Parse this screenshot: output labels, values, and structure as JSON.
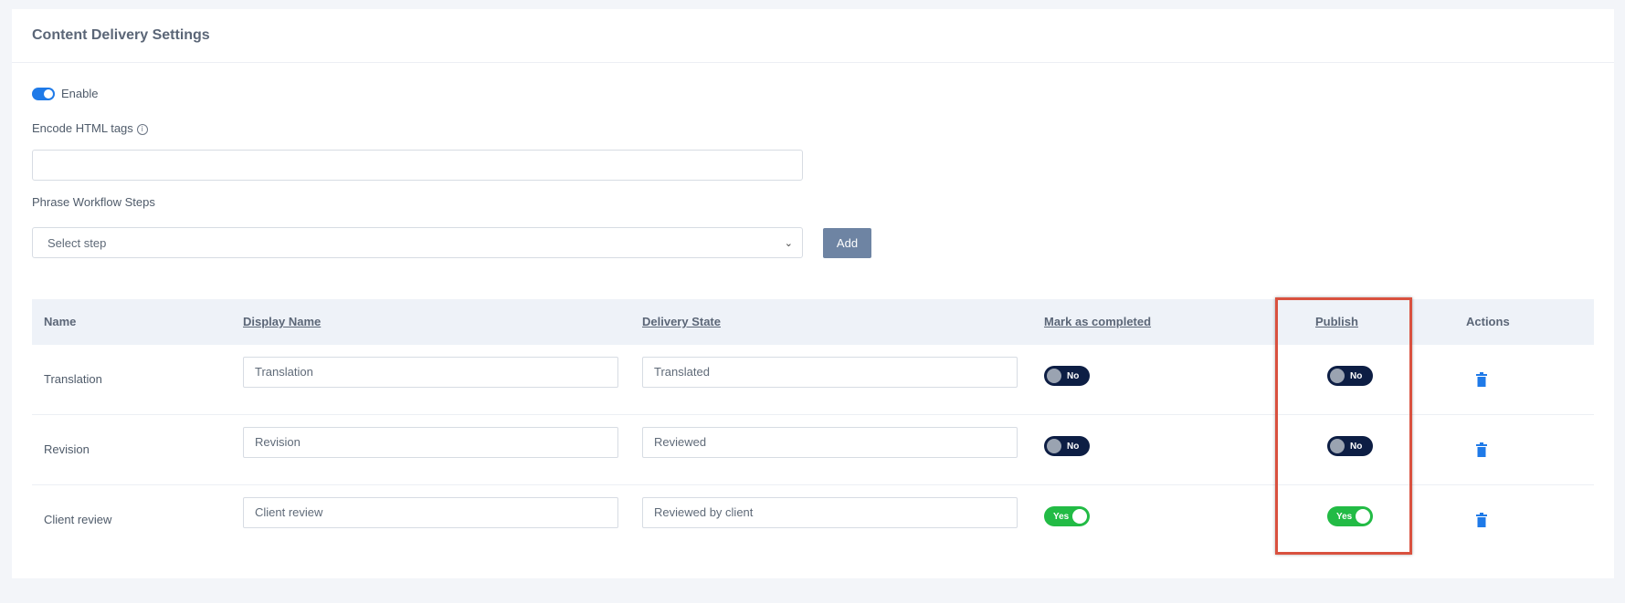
{
  "card": {
    "title": "Content Delivery Settings"
  },
  "enable": {
    "label": "Enable",
    "state": "on"
  },
  "encode": {
    "label": "Encode HTML tags",
    "info_icon": "ⓘ",
    "value": ""
  },
  "workflow": {
    "label": "Phrase Workflow Steps",
    "select_placeholder": "Select step",
    "add_label": "Add"
  },
  "table": {
    "headers": {
      "name": "Name",
      "display_name": "Display Name",
      "delivery_state": "Delivery State",
      "mark_completed": "Mark as completed",
      "publish": "Publish",
      "actions": "Actions"
    },
    "rows": [
      {
        "name": "Translation",
        "display_name": "Translation",
        "delivery_state": "Translated",
        "mark_completed": "No",
        "publish": "No"
      },
      {
        "name": "Revision",
        "display_name": "Revision",
        "delivery_state": "Reviewed",
        "mark_completed": "No",
        "publish": "No"
      },
      {
        "name": "Client review",
        "display_name": "Client review",
        "delivery_state": "Reviewed by client",
        "mark_completed": "Yes",
        "publish": "Yes"
      }
    ]
  },
  "colors": {
    "accent_blue": "#1f7ae8",
    "toggle_off": "#0d1e44",
    "toggle_on": "#22bb45",
    "add_button": "#6e84a3",
    "highlight_border": "#d9513f"
  }
}
